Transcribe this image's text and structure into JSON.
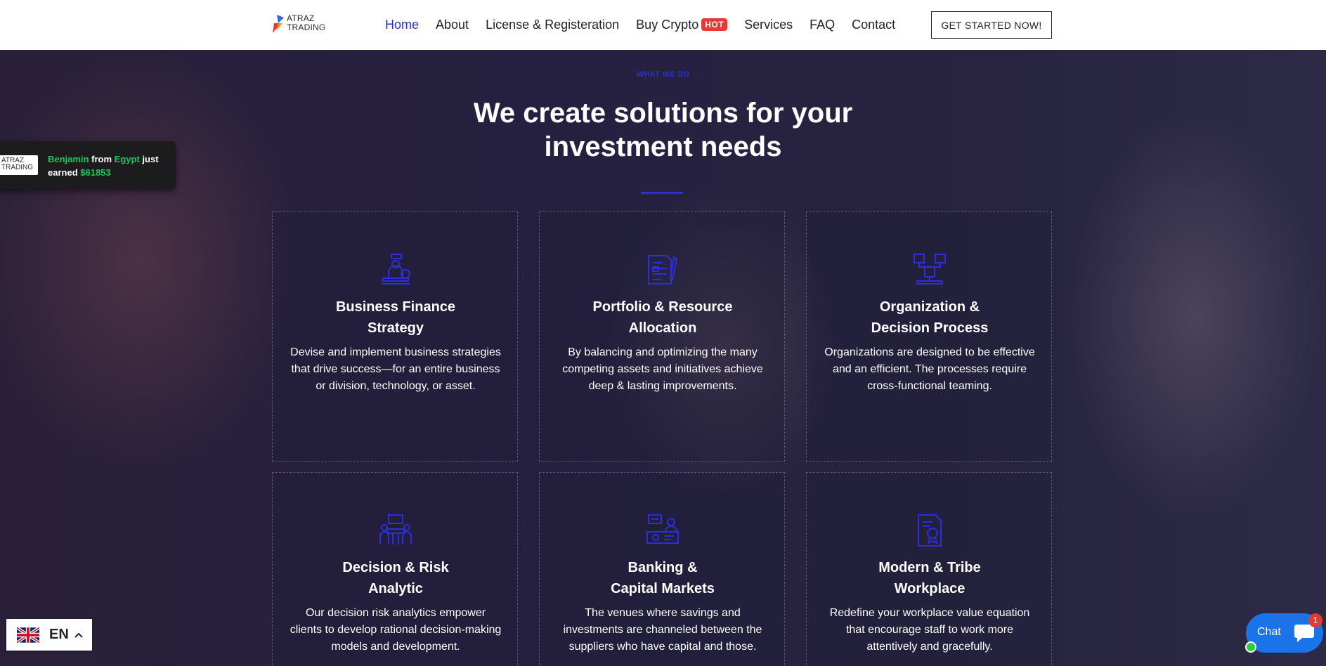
{
  "header": {
    "logo_line1": "ATRAZ",
    "logo_line2": "TRADING",
    "nav": [
      {
        "label": "Home"
      },
      {
        "label": "About"
      },
      {
        "label": "License & Registeration"
      },
      {
        "label": "Buy Crypto",
        "badge": "HOT"
      },
      {
        "label": "Services"
      },
      {
        "label": "FAQ"
      },
      {
        "label": "Contact"
      }
    ],
    "cta_label": "GET STARTED NOW!"
  },
  "hero": {
    "eyebrow": "WHAT WE DO",
    "heading_line1": "We create solutions for your",
    "heading_line2": "investment needs"
  },
  "cards": [
    {
      "icon": "business-person-icon",
      "title_line1": "Business Finance",
      "title_line2": "Strategy",
      "desc": "Devise and implement business strategies that drive success—for an entire business or division, technology, or asset."
    },
    {
      "icon": "document-pen-icon",
      "title_line1": "Portfolio & Resource",
      "title_line2": "Allocation",
      "desc": "By balancing and optimizing the many competing assets and initiatives achieve deep & lasting improvements."
    },
    {
      "icon": "org-chart-icon",
      "title_line1": "Organization &",
      "title_line2": "Decision Process",
      "desc": "Organizations are designed to be effective and an efficient. The processes require cross-functional teaming."
    },
    {
      "icon": "meeting-table-icon",
      "title_line1": "Decision & Risk",
      "title_line2": "Analytic",
      "desc": "Our decision risk analytics empower clients to develop rational decision-making models and development."
    },
    {
      "icon": "banking-icon",
      "title_line1": "Banking &",
      "title_line2": "Capital Markets",
      "desc": "The venues where savings and investments are channeled between the suppliers who have capital and those."
    },
    {
      "icon": "certificate-icon",
      "title_line1": "Modern & Tribe",
      "title_line2": "Workplace",
      "desc": "Redefine your workplace value equation that encourage staff to work more attentively and gracefully."
    }
  ],
  "notification": {
    "logo_line1": "ATRAZ",
    "logo_line2": "TRADING",
    "name": "Benjamin",
    "from": "from",
    "country": "Egypt",
    "just": "just earned",
    "amount": "$61853"
  },
  "language": {
    "code": "EN",
    "flag": "uk-flag-icon"
  },
  "chat": {
    "label": "Chat",
    "badge": "1"
  },
  "colors": {
    "accent": "#2d2fd6",
    "hot": "#e53935",
    "green": "#21c45a",
    "chat": "#1a73e8"
  }
}
